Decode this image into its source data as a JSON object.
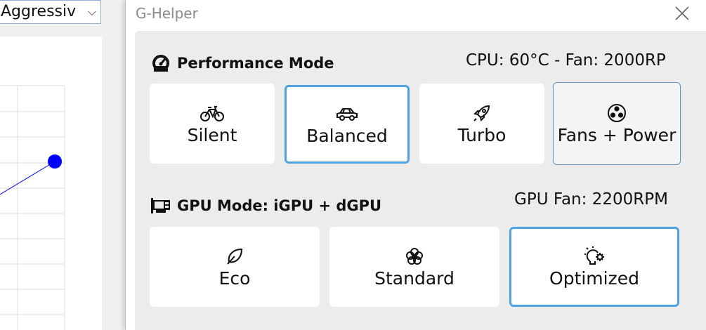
{
  "background_window": {
    "dropdown_value": "Aggressiv"
  },
  "window": {
    "title": "G-Helper"
  },
  "performance": {
    "header": "Performance Mode",
    "status": "CPU: 60°C -  Fan: 2000RP",
    "modes": [
      {
        "label": "Silent",
        "icon": "bicycle-icon",
        "state": "normal"
      },
      {
        "label": "Balanced",
        "icon": "car-icon",
        "state": "selected"
      },
      {
        "label": "Turbo",
        "icon": "rocket-icon",
        "state": "normal"
      },
      {
        "label": "Fans + Power",
        "icon": "fan-icon",
        "state": "outlined"
      }
    ]
  },
  "gpu": {
    "header": "GPU Mode: iGPU + dGPU",
    "status": "GPU Fan: 2200RPM",
    "modes": [
      {
        "label": "Eco",
        "icon": "leaf-icon",
        "state": "normal"
      },
      {
        "label": "Standard",
        "icon": "flower-icon",
        "state": "normal"
      },
      {
        "label": "Optimized",
        "icon": "bulb-gear-icon",
        "state": "selected"
      }
    ]
  },
  "colors": {
    "accent": "#4ea3e0",
    "panel": "#ececec",
    "title_text": "#8a8a8a",
    "chart_point": "#0000ff"
  }
}
